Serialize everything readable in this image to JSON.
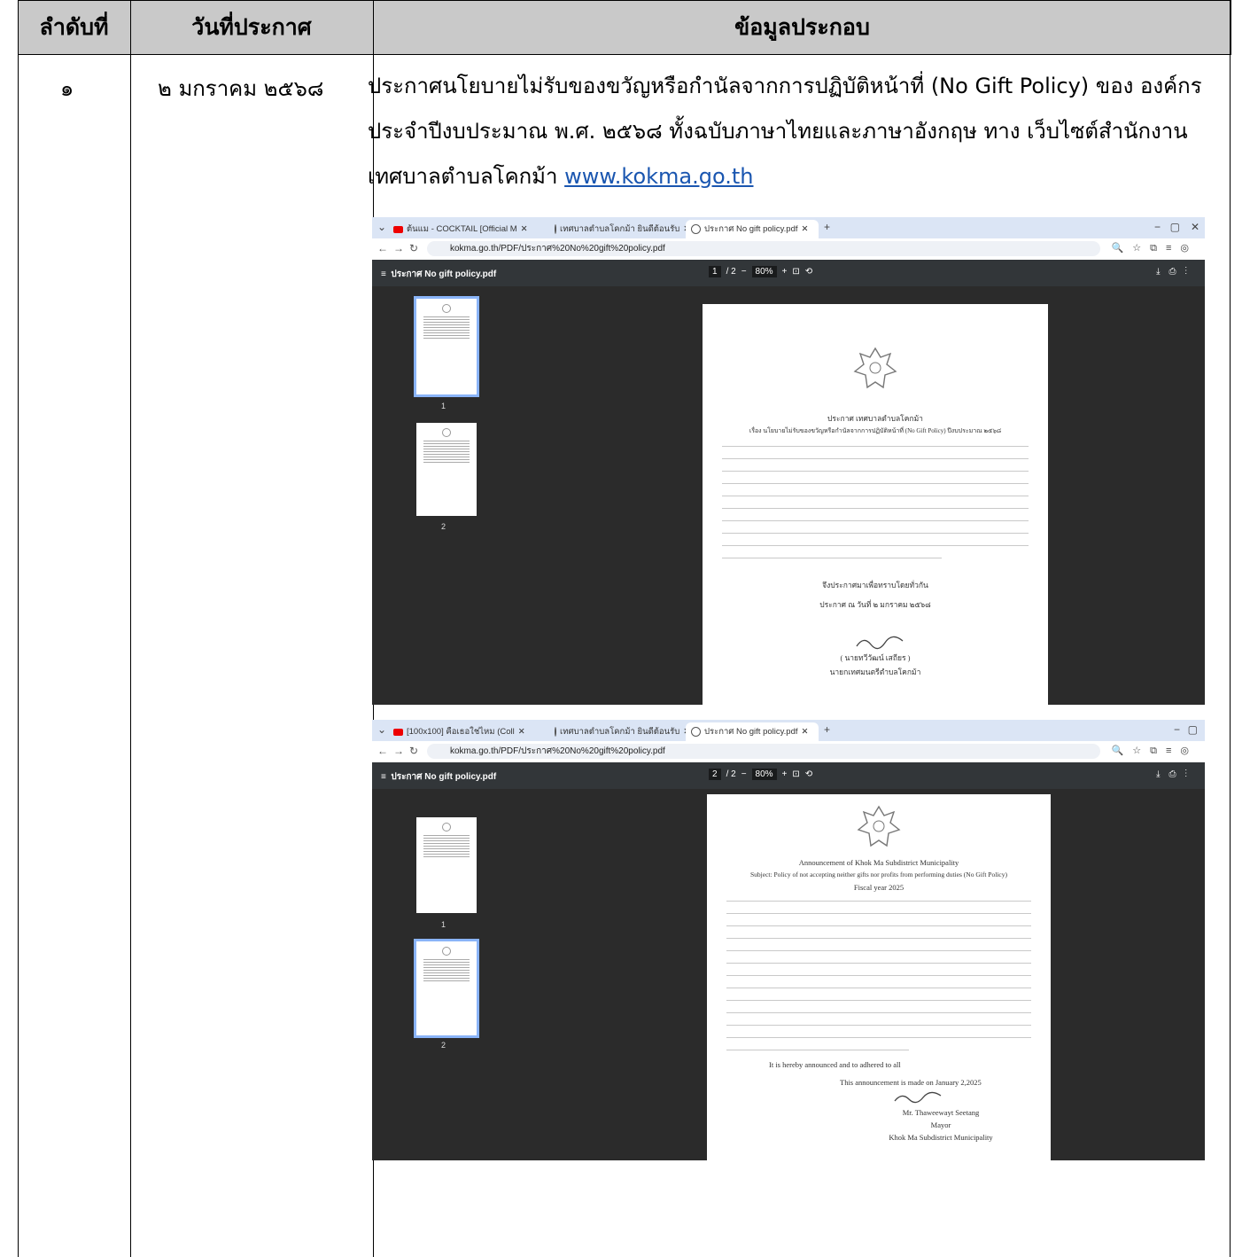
{
  "header": {
    "col1": "ลำดับที่",
    "col2": "วันที่ประกาศ",
    "col3": "ข้อมูลประกอบ"
  },
  "row": {
    "number": "๑",
    "date": "๒ มกราคม ๒๕๖๘",
    "description": "ประกาศนโยบายไม่รับของขวัญหรือกำนัลจากการปฏิบัติหน้าที่ (No Gift Policy) ของ องค์กร ประจำปีงบประมาณ พ.ศ. ๒๕๖๘ ทั้งฉบับภาษาไทยและภาษาอังกฤษ ทาง เว็บไซต์สำนักงานเทศบาลตำบลโคกม้า ",
    "link": "www.kokma.go.th"
  },
  "screenshot1": {
    "tabs": [
      "ต้นแม - COCKTAIL [Official M",
      "เทศบาลตำบลโคกม้า ยินดีต้อนรับ",
      "ประกาศ No gift policy.pdf"
    ],
    "url": "kokma.go.th/PDF/ประกาศ%20No%20gift%20policy.pdf",
    "pdf_title": "ประกาศ No gift policy.pdf",
    "page_current": "1",
    "page_total": "/ 2",
    "zoom": "80%",
    "thumb_labels": [
      "1",
      "2"
    ],
    "doc_heading": "ประกาศ เทศบาลตำบลโคกม้า",
    "doc_subject": "เรื่อง นโยบายไม่รับของขวัญหรือกำนัลจากการปฏิบัติหน้าที่ (No Gift Policy) ปีงบประมาณ ๒๕๖๘",
    "doc_announce": "จึงประกาศมาเพื่อทราบโดยทั่วกัน",
    "doc_date": "ประกาศ ณ วันที่ ๒ มกราคม ๒๕๖๘",
    "doc_name": "( นายทวีวัฒน์ เสถียร )",
    "doc_position": "นายกเทศมนตรีตำบลโคกม้า"
  },
  "screenshot2": {
    "tabs": [
      "[100x100] คือเธอใช่ไหม (Coll",
      "เทศบาลตำบลโคกม้า ยินดีต้อนรับ",
      "ประกาศ No gift policy.pdf"
    ],
    "url": "kokma.go.th/PDF/ประกาศ%20No%20gift%20policy.pdf",
    "pdf_title": "ประกาศ No gift policy.pdf",
    "page_current": "2",
    "page_total": "/ 2",
    "zoom": "80%",
    "thumb_labels": [
      "1",
      "2"
    ],
    "doc_heading": "Announcement of Khok Ma Subdistrict Municipality",
    "doc_subject": "Subject: Policy of not accepting neither gifts nor profits from performing duties (No Gift Policy)",
    "doc_fiscal": "Fiscal year 2025",
    "doc_closing": "It is hereby announced and to adhered to all",
    "doc_date": "This announcement is made on January 2,2025",
    "doc_name": "Mr. Thaweewayt Seetang",
    "doc_position": "Mayor",
    "doc_org": "Khok Ma Subdistrict Municipality"
  }
}
